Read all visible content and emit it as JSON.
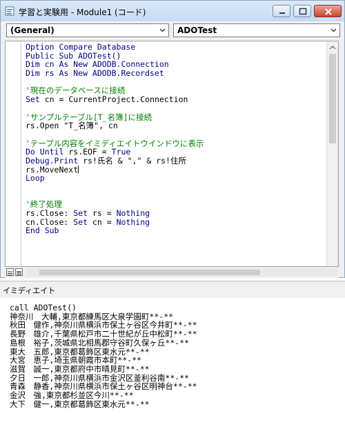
{
  "window": {
    "title": "学習と実験用 - Module1 (コード)",
    "object_combo": "(General)",
    "procedure_combo": "ADOTest"
  },
  "code_lines": [
    {
      "t": "kw",
      "text": "Option Compare Database"
    },
    {
      "t": "kw",
      "text": "Public Sub ADOTest()"
    },
    {
      "t": "kw",
      "text": "Dim cn As New ADODB.Connection"
    },
    {
      "t": "kw",
      "text": "Dim rs As New ADODB.Recordset"
    },
    {
      "t": "tx",
      "text": ""
    },
    {
      "t": "cm",
      "text": "'現在のデータベースに接続"
    },
    {
      "t": "mix",
      "parts": [
        {
          "c": "kw",
          "s": "Set"
        },
        {
          "c": "tx",
          "s": " cn = CurrentProject.Connection"
        }
      ]
    },
    {
      "t": "tx",
      "text": ""
    },
    {
      "t": "cm",
      "text": "'サンプルテーブル[T_名簿]に接続"
    },
    {
      "t": "tx",
      "text": "rs.Open \"T_名簿\", cn"
    },
    {
      "t": "tx",
      "text": ""
    },
    {
      "t": "cm",
      "text": "'テーブル内容をイミディエイトウインドウに表示"
    },
    {
      "t": "mix",
      "parts": [
        {
          "c": "kw",
          "s": "Do Until"
        },
        {
          "c": "tx",
          "s": " rs.EOF = "
        },
        {
          "c": "kw",
          "s": "True"
        }
      ]
    },
    {
      "t": "mix",
      "parts": [
        {
          "c": "kw",
          "s": "Debug.Print"
        },
        {
          "c": "tx",
          "s": " rs!氏名 & \",\" & rs!住所"
        }
      ]
    },
    {
      "t": "tx",
      "text": "rs.MoveNext",
      "caret": true
    },
    {
      "t": "kw",
      "text": "Loop"
    },
    {
      "t": "tx",
      "text": ""
    },
    {
      "t": "tx",
      "text": ""
    },
    {
      "t": "cm",
      "text": "'終了処理"
    },
    {
      "t": "mix",
      "parts": [
        {
          "c": "tx",
          "s": "rs.Close: "
        },
        {
          "c": "kw",
          "s": "Set"
        },
        {
          "c": "tx",
          "s": " rs = "
        },
        {
          "c": "kw",
          "s": "Nothing"
        }
      ]
    },
    {
      "t": "mix",
      "parts": [
        {
          "c": "tx",
          "s": "cn.Close: "
        },
        {
          "c": "kw",
          "s": "Set"
        },
        {
          "c": "tx",
          "s": " cn = "
        },
        {
          "c": "kw",
          "s": "Nothing"
        }
      ]
    },
    {
      "t": "kw",
      "text": "End Sub"
    }
  ],
  "immediate": {
    "title": "イミディエイト",
    "lines": [
      "call ADOTest()",
      "神奈川　大輔,東京都練馬区大泉学園町**-**",
      "秋田　健作,神奈川県横浜市保土ヶ谷区今井町**-**",
      "長野　雄介,千葉県松戸市二十世紀が丘中松町**-**",
      "島根　裕子,茨城県北相馬郡守谷町久保ヶ丘**-**",
      "東大　五郎,東京都葛飾区東水元**-**",
      "大宮　恵子,埼玉県朝霞市本町**-**",
      "滋賀　誠一,東京都府中市晴見町**-**",
      "夕日　一郎,神奈川県横浜市金沢区釜利谷南**-**",
      "青森　静香,神奈川県横浜市保土ヶ谷区明神台**-**",
      "金沢　強,東京都杉並区今川**-**",
      "大下　健一,東京都葛飾区東水元**-**"
    ]
  },
  "colors": {
    "keyword": "#00008b",
    "comment": "#008000",
    "text": "#000000"
  }
}
